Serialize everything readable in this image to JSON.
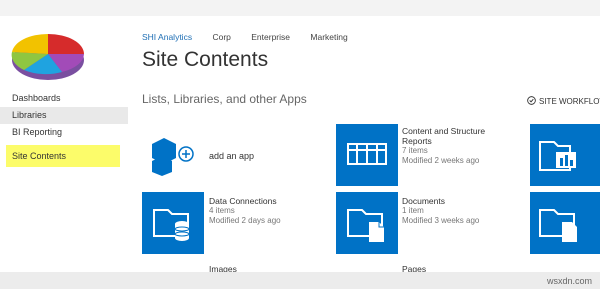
{
  "brand_colors": {
    "accent": "#0072c6",
    "highlight": "#fcfc6a"
  },
  "logo": {
    "icon": "pie-chart-logo-icon"
  },
  "sidebar": {
    "items": [
      {
        "label": "Dashboards"
      },
      {
        "label": "Libraries"
      },
      {
        "label": "BI Reporting"
      },
      {
        "label": "Site Contents"
      }
    ]
  },
  "topnav": {
    "items": [
      "SHI Analytics",
      "Corp",
      "Enterprise",
      "Marketing"
    ]
  },
  "page": {
    "title": "Site Contents",
    "subtitle": "Lists, Libraries, and other Apps",
    "site_workflows": "SITE WORKFLOW"
  },
  "tiles": {
    "add_app": {
      "label": "add an app",
      "icon": "add-app-icon"
    },
    "content_structure": {
      "name": "Content and Structure Reports",
      "count": "7 items",
      "modified": "Modified 2 weeks ago",
      "icon": "list-grid-icon"
    },
    "data_connections": {
      "name": "Data Connections",
      "count": "4 items",
      "modified": "Modified 2 days ago",
      "icon": "database-folder-icon"
    },
    "documents": {
      "name": "Documents",
      "count": "1 item",
      "modified": "Modified 3 weeks ago",
      "icon": "document-folder-icon"
    },
    "images_partial": {
      "name": "Images",
      "icon": "image-folder-icon"
    },
    "pages_partial": {
      "name": "Pages",
      "icon": "page-folder-icon"
    }
  },
  "watermark": "wsxdn.com"
}
